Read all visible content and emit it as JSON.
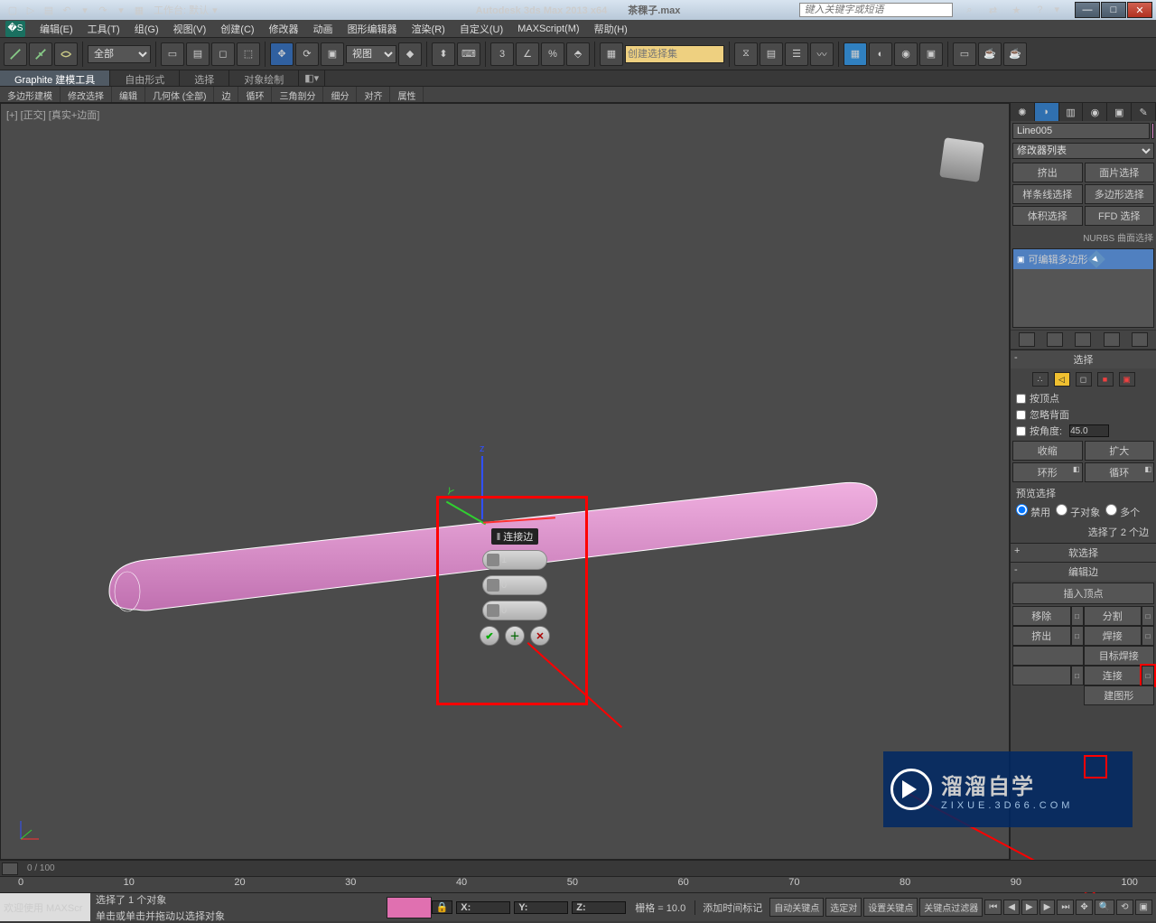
{
  "titlebar": {
    "workspace_label": "工作台: 默认",
    "app_title": "Autodesk 3ds Max  2013 x64",
    "file_name": "茶稞子.max",
    "search_placeholder": "键入关键字或短语"
  },
  "menus": [
    "编辑(E)",
    "工具(T)",
    "组(G)",
    "视图(V)",
    "创建(C)",
    "修改器",
    "动画",
    "图形编辑器",
    "渲染(R)",
    "自定义(U)",
    "MAXScript(M)",
    "帮助(H)"
  ],
  "toolbar": {
    "filter": "全部",
    "view_mode": "视图",
    "named_set_placeholder": "创建选择集"
  },
  "ribbon_tabs": [
    "Graphite 建模工具",
    "自由形式",
    "选择",
    "对象绘制"
  ],
  "ribbon_sub": [
    "多边形建模",
    "修改选择",
    "编辑",
    "几何体 (全部)",
    "边",
    "循环",
    "三角剖分",
    "细分",
    "对齐",
    "属性"
  ],
  "viewport_label": "[+] [正交] [真实+边面]",
  "caddy": {
    "title": "‖ 连接边",
    "v1": "1",
    "v2": "0",
    "v3": "0"
  },
  "cmdpanel": {
    "obj_name": "Line005",
    "modlist_placeholder": "修改器列表",
    "btns": [
      "挤出",
      "面片选择",
      "样条线选择",
      "多边形选择",
      "体积选择",
      "FFD 选择"
    ],
    "nurbs_label": "NURBS 曲面选择",
    "stack_item": "可编辑多边形",
    "rollout_sel": "选择",
    "by_vertex": "按顶点",
    "ignore_back": "忽略背面",
    "by_angle": "按角度:",
    "angle_val": "45.0",
    "shrink": "收缩",
    "grow": "扩大",
    "ring": "环形",
    "loop": "循环",
    "preview_label": "预览选择",
    "radio_off": "禁用",
    "radio_sub": "子对象",
    "radio_multi": "多个",
    "sel_count": "选择了 2 个边",
    "rollout_soft": "软选择",
    "rollout_edit": "编辑边",
    "insert_vert": "插入顶点",
    "remove": "移除",
    "split": "分割",
    "extrude": "挤出",
    "weld": "焊接",
    "target_weld": "目标焊接",
    "connect": "连接",
    "create_shape": "建图形"
  },
  "trackbar": {
    "frames": "0 / 100"
  },
  "timeline_ticks": [
    "0",
    "10",
    "20",
    "30",
    "40",
    "50",
    "60",
    "70",
    "80",
    "90",
    "100"
  ],
  "statusbar": {
    "welcome": "欢迎使用  MAXScr",
    "sel_info": "选择了 1 个对象",
    "hint": "单击或单击并拖动以选择对象",
    "x": "X:",
    "y": "Y:",
    "z": "Z:",
    "grid": "栅格 = 10.0",
    "add_marker": "添加时间标记",
    "auto_key": "自动关键点",
    "set_key": "设置关键点",
    "selected_label": "选定对",
    "key_filter": "关键点过滤器"
  },
  "watermark": {
    "big": "溜溜自学",
    "sm": "ZIXUE.3D66.COM"
  }
}
